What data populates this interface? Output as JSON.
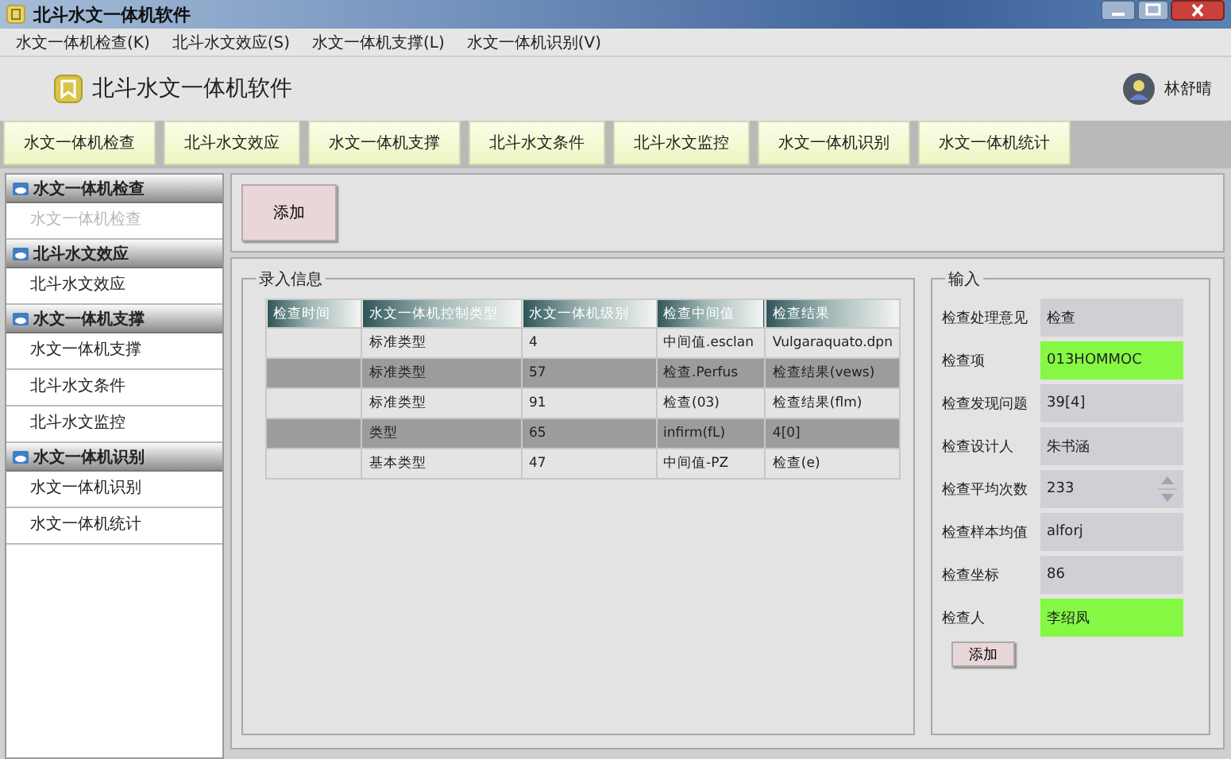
{
  "window": {
    "title": "北斗水文一体机软件"
  },
  "menu": [
    "水文一体机检查(K)",
    "北斗水文效应(S)",
    "水文一体机支撑(L)",
    "水文一体机识别(V)"
  ],
  "header": {
    "app_name": "北斗水文一体机软件",
    "user_name": "林舒晴"
  },
  "tabs": [
    {
      "label": "水文一体机检查",
      "selected": false
    },
    {
      "label": "北斗水文效应",
      "selected": false
    },
    {
      "label": "水文一体机支撑",
      "selected": false
    },
    {
      "label": "北斗水文条件",
      "selected": false
    },
    {
      "label": "北斗水文监控",
      "selected": false
    },
    {
      "label": "水文一体机识别",
      "selected": false
    },
    {
      "label": "水文一体机统计",
      "selected": false
    }
  ],
  "sidebar": {
    "groups": [
      {
        "label": "水文一体机检查",
        "children": [
          {
            "label": "水文一体机检查",
            "disabled": true
          }
        ]
      },
      {
        "label": "北斗水文效应",
        "children": [
          {
            "label": "北斗水文效应",
            "disabled": false
          }
        ]
      },
      {
        "label": "水文一体机支撑",
        "children": [
          {
            "label": "水文一体机支撑",
            "disabled": false
          },
          {
            "label": "北斗水文条件",
            "disabled": false
          },
          {
            "label": "北斗水文监控",
            "disabled": false
          }
        ]
      },
      {
        "label": "水文一体机识别",
        "children": [
          {
            "label": "水文一体机识别",
            "disabled": false
          },
          {
            "label": "水文一体机统计",
            "disabled": false
          }
        ]
      }
    ]
  },
  "toolbar": {
    "add_button": "添加"
  },
  "entry": {
    "title": "录入信息",
    "columns": [
      "检查时间",
      "水文一体机控制类型",
      "水文一体机级别",
      "检查中间值",
      "检查结果"
    ],
    "rows": [
      [
        "",
        "标准类型",
        "4",
        "中间值.esclan",
        "Vulgaraquato.dpn"
      ],
      [
        "",
        "标准类型",
        "57",
        "检查.Perfus",
        "检查结果(vews)"
      ],
      [
        "",
        "标准类型",
        "91",
        "检查(03)",
        "检查结果(flm)"
      ],
      [
        "",
        "类型",
        "65",
        "infirm(fL)",
        "4[0]"
      ],
      [
        "",
        "基本类型",
        "47",
        "中间值-PZ",
        "检查(e)"
      ]
    ]
  },
  "input": {
    "title": "输入",
    "fields": [
      {
        "label": "检查处理意见",
        "value": "检查",
        "kind": "text",
        "highlighted": false
      },
      {
        "label": "检查项",
        "value": "013HOMMOC",
        "kind": "text",
        "highlighted": true
      },
      {
        "label": "检查发现问题",
        "value": "39[4]",
        "kind": "text",
        "highlighted": false
      },
      {
        "label": "检查设计人",
        "value": "朱书涵",
        "kind": "text",
        "highlighted": false
      },
      {
        "label": "检查平均次数",
        "value": "233",
        "kind": "spinner",
        "highlighted": false
      },
      {
        "label": "检查样本均值",
        "value": "alforj",
        "kind": "text",
        "highlighted": false
      },
      {
        "label": "检查坐标",
        "value": "86",
        "kind": "text",
        "highlighted": false
      },
      {
        "label": "检查人",
        "value": "李绍凤",
        "kind": "text",
        "highlighted": true
      }
    ],
    "add_button": "添加"
  }
}
